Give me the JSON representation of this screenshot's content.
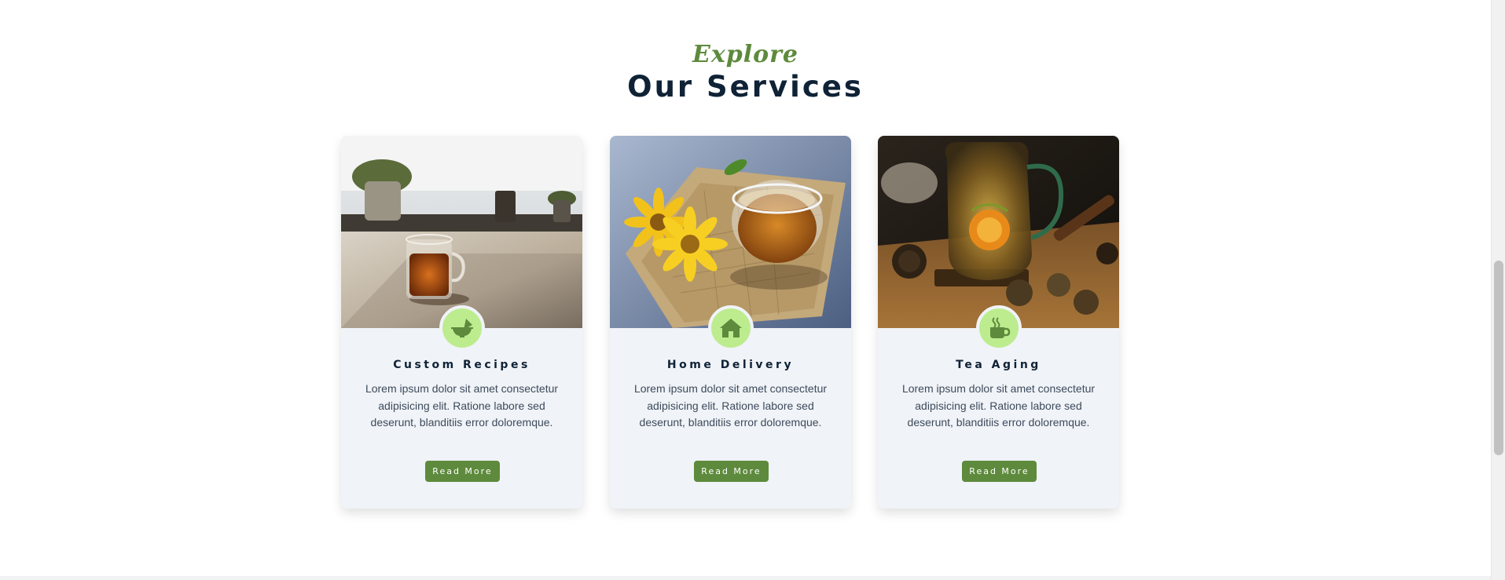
{
  "section": {
    "eyebrow": "Explore",
    "title": "Our Services"
  },
  "services": [
    {
      "title": "Custom Recipes",
      "description": "Lorem ipsum dolor sit amet consectetur adipisicing elit. Ratione labore sed deserunt, blanditiis error doloremque.",
      "button_label": "Read More",
      "icon": "mortar-pestle-icon",
      "image": "tea-cup-on-windowsill-photo"
    },
    {
      "title": "Home Delivery",
      "description": "Lorem ipsum dolor sit amet consectetur adipisicing elit. Ratione labore sed deserunt, blanditiis error doloremque.",
      "button_label": "Read More",
      "icon": "home-icon",
      "image": "tea-bowl-with-yellow-flowers-photo"
    },
    {
      "title": "Tea Aging",
      "description": "Lorem ipsum dolor sit amet consectetur adipisicing elit. Ratione labore sed deserunt, blanditiis error doloremque.",
      "button_label": "Read More",
      "icon": "mug-hot-icon",
      "image": "flowering-tea-glass-pot-photo"
    }
  ],
  "colors": {
    "accent_green": "#5d8a3c",
    "badge_green": "#bdec8f",
    "title_navy": "#0f2236",
    "card_background": "#f0f3f7"
  }
}
